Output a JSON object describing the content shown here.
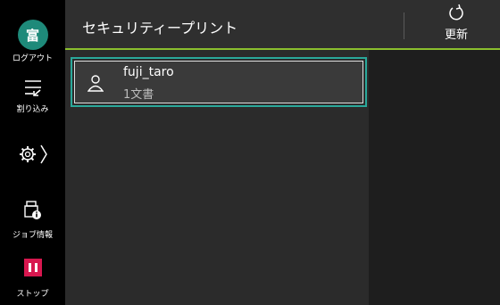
{
  "sidebar": {
    "avatar_char": "富",
    "logout_label": "ログアウト",
    "interrupt_label": "割り込み",
    "job_info_label": "ジョブ情報",
    "stop_label": "ストップ"
  },
  "header": {
    "title": "セキュリティープリント",
    "refresh_label": "更新"
  },
  "jobs": [
    {
      "user": "fuji_taro",
      "doc_count": "1文書"
    }
  ],
  "colors": {
    "accent_teal": "#2aa89a",
    "header_underline": "#8bbf2e",
    "avatar_bg": "#1e8a7a",
    "stop_red": "#d8174f"
  }
}
